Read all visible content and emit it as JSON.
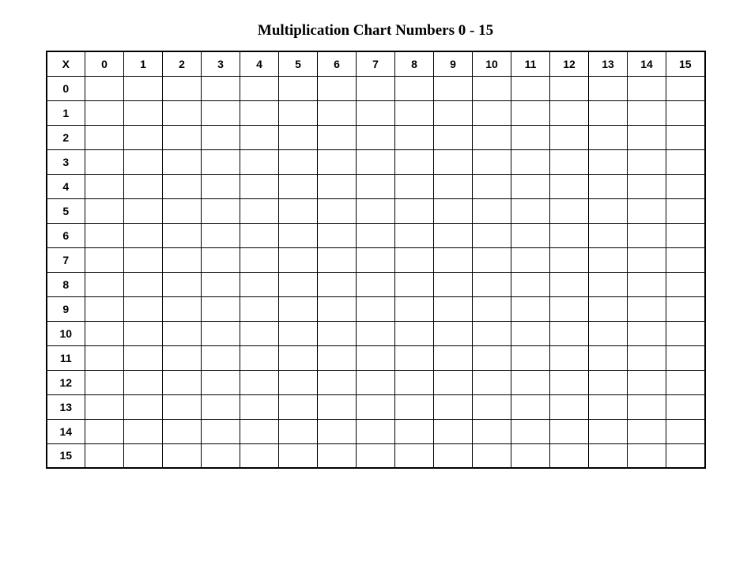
{
  "title": "Multiplication Chart Numbers 0 - 15",
  "corner_label": "X",
  "col_headers": [
    "0",
    "1",
    "2",
    "3",
    "4",
    "5",
    "6",
    "7",
    "8",
    "9",
    "10",
    "11",
    "12",
    "13",
    "14",
    "15"
  ],
  "row_headers": [
    "0",
    "1",
    "2",
    "3",
    "4",
    "5",
    "6",
    "7",
    "8",
    "9",
    "10",
    "11",
    "12",
    "13",
    "14",
    "15"
  ],
  "chart_data": {
    "type": "table",
    "title": "Multiplication Chart Numbers 0 - 15",
    "xlabel": "",
    "ylabel": "",
    "columns": [
      "0",
      "1",
      "2",
      "3",
      "4",
      "5",
      "6",
      "7",
      "8",
      "9",
      "10",
      "11",
      "12",
      "13",
      "14",
      "15"
    ],
    "rows": [
      "0",
      "1",
      "2",
      "3",
      "4",
      "5",
      "6",
      "7",
      "8",
      "9",
      "10",
      "11",
      "12",
      "13",
      "14",
      "15"
    ],
    "values": [
      [
        "",
        "",
        "",
        "",
        "",
        "",
        "",
        "",
        "",
        "",
        "",
        "",
        "",
        "",
        "",
        ""
      ],
      [
        "",
        "",
        "",
        "",
        "",
        "",
        "",
        "",
        "",
        "",
        "",
        "",
        "",
        "",
        "",
        ""
      ],
      [
        "",
        "",
        "",
        "",
        "",
        "",
        "",
        "",
        "",
        "",
        "",
        "",
        "",
        "",
        "",
        ""
      ],
      [
        "",
        "",
        "",
        "",
        "",
        "",
        "",
        "",
        "",
        "",
        "",
        "",
        "",
        "",
        "",
        ""
      ],
      [
        "",
        "",
        "",
        "",
        "",
        "",
        "",
        "",
        "",
        "",
        "",
        "",
        "",
        "",
        "",
        ""
      ],
      [
        "",
        "",
        "",
        "",
        "",
        "",
        "",
        "",
        "",
        "",
        "",
        "",
        "",
        "",
        "",
        ""
      ],
      [
        "",
        "",
        "",
        "",
        "",
        "",
        "",
        "",
        "",
        "",
        "",
        "",
        "",
        "",
        "",
        ""
      ],
      [
        "",
        "",
        "",
        "",
        "",
        "",
        "",
        "",
        "",
        "",
        "",
        "",
        "",
        "",
        "",
        ""
      ],
      [
        "",
        "",
        "",
        "",
        "",
        "",
        "",
        "",
        "",
        "",
        "",
        "",
        "",
        "",
        "",
        ""
      ],
      [
        "",
        "",
        "",
        "",
        "",
        "",
        "",
        "",
        "",
        "",
        "",
        "",
        "",
        "",
        "",
        ""
      ],
      [
        "",
        "",
        "",
        "",
        "",
        "",
        "",
        "",
        "",
        "",
        "",
        "",
        "",
        "",
        "",
        ""
      ],
      [
        "",
        "",
        "",
        "",
        "",
        "",
        "",
        "",
        "",
        "",
        "",
        "",
        "",
        "",
        "",
        ""
      ],
      [
        "",
        "",
        "",
        "",
        "",
        "",
        "",
        "",
        "",
        "",
        "",
        "",
        "",
        "",
        "",
        ""
      ],
      [
        "",
        "",
        "",
        "",
        "",
        "",
        "",
        "",
        "",
        "",
        "",
        "",
        "",
        "",
        "",
        ""
      ],
      [
        "",
        "",
        "",
        "",
        "",
        "",
        "",
        "",
        "",
        "",
        "",
        "",
        "",
        "",
        "",
        ""
      ],
      [
        "",
        "",
        "",
        "",
        "",
        "",
        "",
        "",
        "",
        "",
        "",
        "",
        "",
        "",
        "",
        ""
      ]
    ]
  }
}
